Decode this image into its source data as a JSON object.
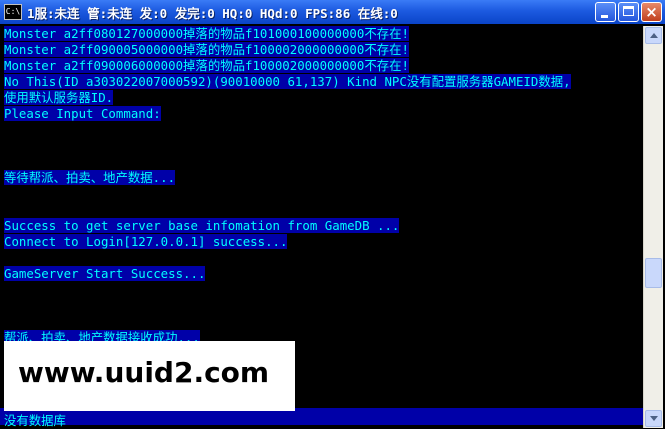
{
  "window": {
    "title": "1服:未连 管:未连 发:0 发完:0 HQ:0 HQd:0 FPS:86 在线:0",
    "icon_label": "C:\\"
  },
  "console": {
    "lines": [
      {
        "text": "Monster  a2ff080127000000掉落的物品f101000100000000不存在!",
        "selected": true
      },
      {
        "text": "Monster  a2ff090005000000掉落的物品f100002000000000不存在!",
        "selected": true
      },
      {
        "text": "Monster  a2ff090006000000掉落的物品f100002000000000不存在!",
        "selected": true
      },
      {
        "text": "No This(ID a303022007000592)(90010000 61,137) Kind NPC没有配置服务器GAMEID数据,",
        "selected": true
      },
      {
        "text": "使用默认服务器ID.",
        "selected": true
      },
      {
        "text": "Please Input Command:",
        "selected": true
      },
      {
        "text": "",
        "selected": false
      },
      {
        "text": "",
        "selected": false
      },
      {
        "text": "",
        "selected": false
      },
      {
        "text": "等待帮派、拍卖、地产数据...",
        "selected": true
      },
      {
        "text": "",
        "selected": false
      },
      {
        "text": "",
        "selected": false
      },
      {
        "text": "Success to get server base infomation from GameDB ...",
        "selected": true
      },
      {
        "text": "Connect to Login[127.0.0.1] success...",
        "selected": true
      },
      {
        "text": "",
        "selected": false
      },
      {
        "text": "GameServer Start Success...",
        "selected": true
      },
      {
        "text": "",
        "selected": false
      },
      {
        "text": "",
        "selected": false
      },
      {
        "text": "",
        "selected": false
      },
      {
        "text": "帮派、拍卖、地产数据接收成功...",
        "selected": true
      }
    ],
    "bottom_text": "没有数据库",
    "text_color": "#00ffff",
    "selection_color": "#0000a8",
    "background": "#000000"
  },
  "watermark": {
    "text": "www.uuid2.com"
  },
  "icons": {
    "app": "console-app-icon",
    "minimize": "minimize-icon",
    "maximize": "maximize-icon",
    "close": "close-icon",
    "scroll_up": "arrow-up-icon",
    "scroll_down": "arrow-down-icon"
  }
}
